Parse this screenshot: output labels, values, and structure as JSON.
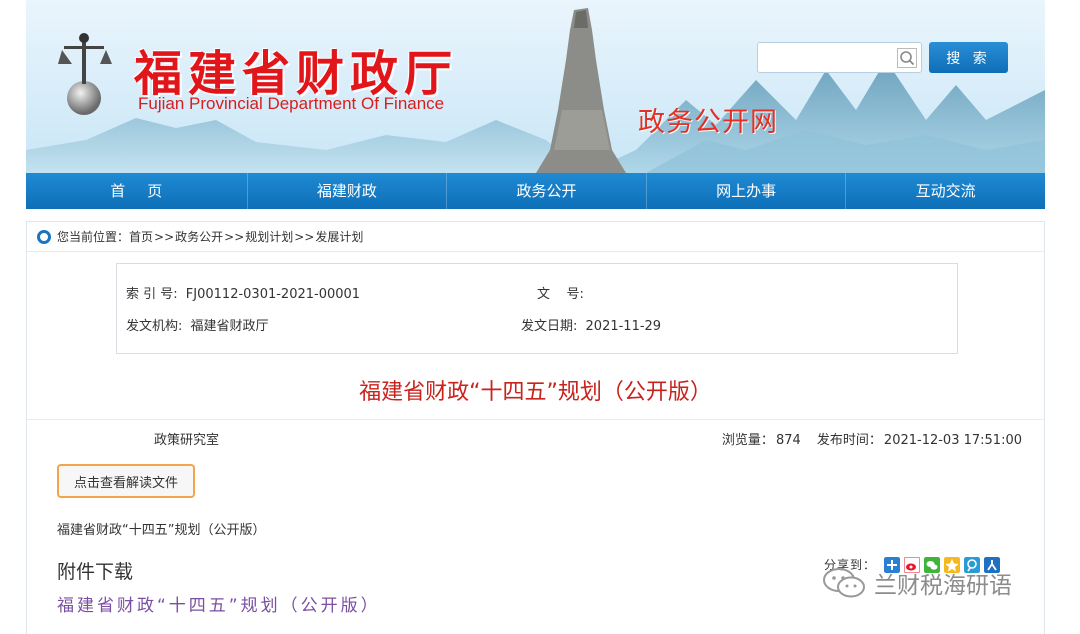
{
  "header": {
    "title_cn": "福建省财政厅",
    "title_en": "Fujian Provincial Department Of Finance",
    "portal_name": "政务公开网",
    "search": {
      "placeholder": "",
      "button_label": "搜 索"
    }
  },
  "nav": {
    "items": [
      {
        "label": "首页"
      },
      {
        "label": "福建财政"
      },
      {
        "label": "政务公开"
      },
      {
        "label": "网上办事"
      },
      {
        "label": "互动交流"
      }
    ]
  },
  "breadcrumb": {
    "prefix": "您当前位置：",
    "items": [
      "首页",
      "政务公开",
      "规划计划",
      "发展计划"
    ],
    "separator": ">>"
  },
  "meta": {
    "index_label": "索 引 号:",
    "index_value": "FJ00112-0301-2021-00001",
    "doc_no_label": "文    号:",
    "doc_no_value": "",
    "issuer_label": "发文机构:",
    "issuer_value": "福建省财政厅",
    "date_label": "发文日期:",
    "date_value": "2021-11-29"
  },
  "article": {
    "title": "福建省财政“十四五”规划（公开版）",
    "source": "政策研究室",
    "views_label": "浏览量：",
    "views_value": "874",
    "published_label": "发布时间：",
    "published_value": "2021-12-03 17:51:00",
    "interpret_button": "点击查看解读文件",
    "body_text": "福建省财政“十四五”规划（公开版）",
    "attachments_heading": "附件下载",
    "attachment_link": "福建省财政“十四五”规划（公开版）"
  },
  "share": {
    "label": "分享到：",
    "icons": [
      {
        "name": "plus-share-icon",
        "color": "#2a7fd4"
      },
      {
        "name": "weibo-icon",
        "color": "#e6162d"
      },
      {
        "name": "wechat-icon",
        "color": "#3fb43a"
      },
      {
        "name": "qzone-icon",
        "color": "#f5b91d"
      },
      {
        "name": "tencent-weibo-icon",
        "color": "#2b9bd6"
      },
      {
        "name": "renren-icon",
        "color": "#1f6fc3"
      }
    ]
  },
  "watermark": {
    "text": "兰财税海研语"
  },
  "colors": {
    "brand_red": "#e0161b",
    "nav_blue": "#0d6fb8",
    "title_red": "#c8231d",
    "link_purple": "#7a4fa3",
    "button_orange": "#f5a44a"
  }
}
